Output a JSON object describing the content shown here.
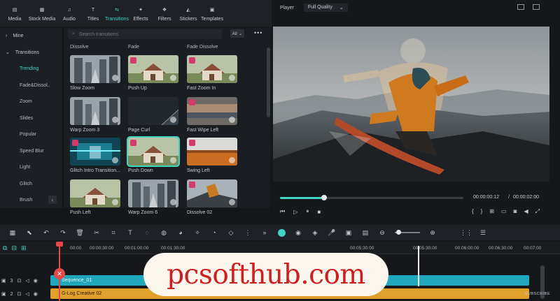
{
  "toolbar": {
    "items": [
      {
        "label": "Media",
        "icon": "media-icon"
      },
      {
        "label": "Stock Media",
        "icon": "stock-media-icon"
      },
      {
        "label": "Audio",
        "icon": "audio-icon"
      },
      {
        "label": "Titles",
        "icon": "titles-icon"
      },
      {
        "label": "Transitions",
        "icon": "transitions-icon",
        "active": true
      },
      {
        "label": "Effects",
        "icon": "effects-icon"
      },
      {
        "label": "Filters",
        "icon": "filters-icon"
      },
      {
        "label": "Stickers",
        "icon": "stickers-icon"
      },
      {
        "label": "Templates",
        "icon": "templates-icon"
      }
    ]
  },
  "categories": {
    "top": [
      {
        "label": "Mine"
      },
      {
        "label": "Transitions"
      }
    ],
    "items": [
      "Trending",
      "Fade&Dissol..",
      "Zoom",
      "Slides",
      "Popular",
      "Speed Blur",
      "Light",
      "Glitch",
      "Brush"
    ],
    "active": "Trending"
  },
  "search": {
    "placeholder": "Search transitions"
  },
  "filter": {
    "value": "All"
  },
  "columns": [
    "Dissolve",
    "Fade",
    "Fade Dissolve"
  ],
  "tiles": [
    {
      "label": "Slow Zoom",
      "thumb": "city"
    },
    {
      "label": "Push Up",
      "thumb": "house",
      "premium": true
    },
    {
      "label": "Fast Zoom In",
      "thumb": "house",
      "premium": true
    },
    {
      "label": "Warp Zoom 3",
      "thumb": "city"
    },
    {
      "label": "Page Curl",
      "thumb": "dark"
    },
    {
      "label": "Fast Wipe Left",
      "thumb": "blur",
      "premium": true
    },
    {
      "label": "Glitch Intro Transition...",
      "thumb": "glitch",
      "premium": true
    },
    {
      "label": "Push Down",
      "thumb": "house",
      "premium": true,
      "selected": true
    },
    {
      "label": "Swing Left",
      "thumb": "orange",
      "premium": true
    },
    {
      "label": "Push Left",
      "thumb": "house"
    },
    {
      "label": "Warp Zoom 6",
      "thumb": "city"
    },
    {
      "label": "Dissolve 02",
      "thumb": "snow",
      "premium": true
    }
  ],
  "player": {
    "label": "Player",
    "quality": "Full Quality",
    "current_time": "00:00:00:12",
    "separator": "/",
    "total_time": "00:00:02:00",
    "progress": 0.24
  },
  "ruler": {
    "ticks": [
      "00:00",
      "00:00:30:00",
      "00:01:00:00",
      "00:01:30:00",
      "00:05:30:00",
      "00:05:30:00",
      "00:06:00:00",
      "00:06:30:00",
      "00:07:00"
    ]
  },
  "tracks": [
    {
      "id": "3",
      "clip": "Sequence_01",
      "color": "#21a7bb"
    },
    {
      "id": "2",
      "clip": "G-Log Creative 02",
      "color": "#e0a12c"
    }
  ],
  "watermark": "pcsofthub.com",
  "subscribe": "SUBSCRIBE",
  "colors": {
    "accent": "#3fd6c3",
    "playhead": "#e54848"
  }
}
